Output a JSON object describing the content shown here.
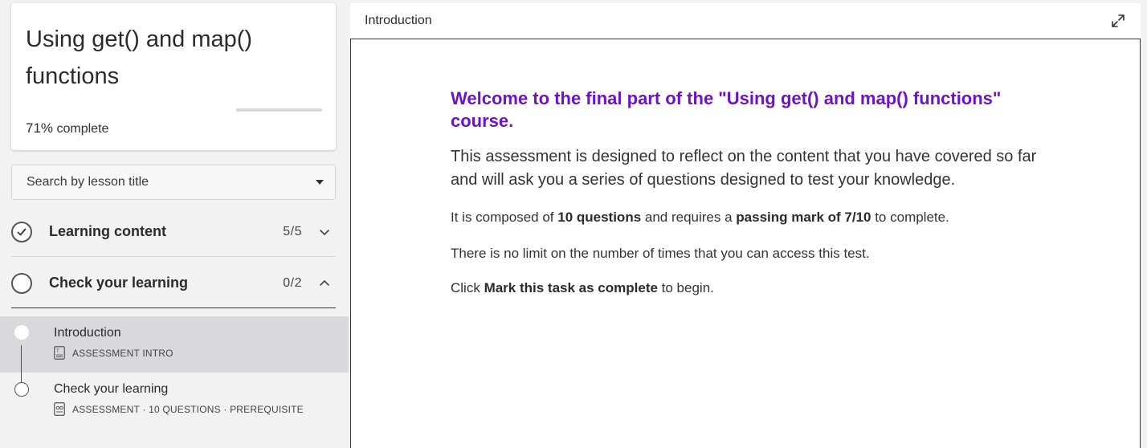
{
  "course": {
    "title": "Using get() and map() functions",
    "progress_pct": "71%",
    "progress_label": "complete",
    "progress_value": 0.71
  },
  "search": {
    "placeholder": "Search by lesson title"
  },
  "sections": [
    {
      "label": "Learning content",
      "count": "5/5",
      "status": "complete",
      "expanded": false
    },
    {
      "label": "Check your learning",
      "count": "0/2",
      "status": "incomplete",
      "expanded": true
    }
  ],
  "lessons": [
    {
      "title": "Introduction",
      "meta": "ASSESSMENT INTRO",
      "icon": "text-document-icon",
      "active": true
    },
    {
      "title": "Check your learning",
      "meta": "ASSESSMENT · 10 QUESTIONS · PREREQUISITE",
      "icon": "quiz-document-icon",
      "active": false
    }
  ],
  "main": {
    "header_title": "Introduction",
    "welcome": "Welcome to the final part of the \"Using get() and map() functions\" course.",
    "lead": "This assessment is designed to reflect on the content that you have covered so far and will ask you a series of questions designed to test your knowledge.",
    "p1_pre": "It is composed of ",
    "p1_b1": "10 questions",
    "p1_mid": " and requires a ",
    "p1_b2": "passing mark of 7/10",
    "p1_post": " to complete.",
    "p2": "There is no limit on the number of times that you can access this test.",
    "p3_pre": "Click ",
    "p3_b": "Mark this task as complete",
    "p3_post": " to begin."
  },
  "colors": {
    "accent": "#6d12c4",
    "sidebar_bg": "#f2f2f3",
    "active_row": "#d9d9dc"
  }
}
